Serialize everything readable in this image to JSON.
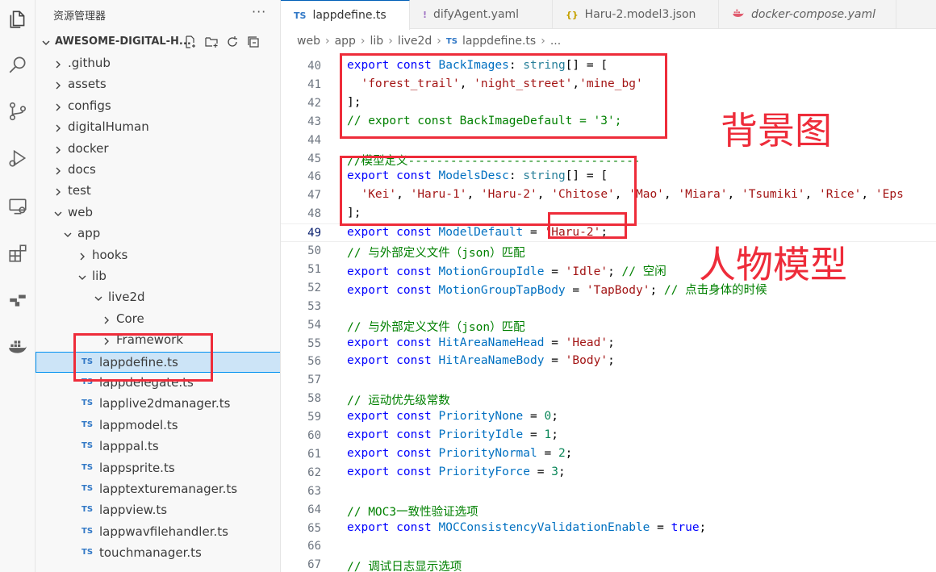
{
  "explorer": {
    "title": "资源管理器",
    "more": "···",
    "project": "AWESOME-DIGITAL-H...",
    "tree": [
      {
        "label": ".github",
        "depth": 0,
        "type": "folder",
        "open": false
      },
      {
        "label": "assets",
        "depth": 0,
        "type": "folder",
        "open": false
      },
      {
        "label": "configs",
        "depth": 0,
        "type": "folder",
        "open": false
      },
      {
        "label": "digitalHuman",
        "depth": 0,
        "type": "folder",
        "open": false
      },
      {
        "label": "docker",
        "depth": 0,
        "type": "folder",
        "open": false
      },
      {
        "label": "docs",
        "depth": 0,
        "type": "folder",
        "open": false
      },
      {
        "label": "test",
        "depth": 0,
        "type": "folder",
        "open": false
      },
      {
        "label": "web",
        "depth": 0,
        "type": "folder",
        "open": true
      },
      {
        "label": "app",
        "depth": 1,
        "type": "folder",
        "open": true
      },
      {
        "label": "hooks",
        "depth": 2,
        "type": "folder",
        "open": false
      },
      {
        "label": "lib",
        "depth": 2,
        "type": "folder",
        "open": true
      },
      {
        "label": "live2d",
        "depth": 3,
        "type": "folder",
        "open": true
      },
      {
        "label": "Core",
        "depth": 4,
        "type": "folder",
        "open": false
      },
      {
        "label": "Framework",
        "depth": 4,
        "type": "folder",
        "open": false
      },
      {
        "label": "lappdefine.ts",
        "depth": 4,
        "type": "ts",
        "selected": true
      },
      {
        "label": "lappdelegate.ts",
        "depth": 4,
        "type": "ts"
      },
      {
        "label": "lapplive2dmanager.ts",
        "depth": 4,
        "type": "ts"
      },
      {
        "label": "lappmodel.ts",
        "depth": 4,
        "type": "ts"
      },
      {
        "label": "lapppal.ts",
        "depth": 4,
        "type": "ts"
      },
      {
        "label": "lappsprite.ts",
        "depth": 4,
        "type": "ts"
      },
      {
        "label": "lapptexturemanager.ts",
        "depth": 4,
        "type": "ts"
      },
      {
        "label": "lappview.ts",
        "depth": 4,
        "type": "ts"
      },
      {
        "label": "lappwavfilehandler.ts",
        "depth": 4,
        "type": "ts"
      },
      {
        "label": "touchmanager.ts",
        "depth": 4,
        "type": "ts"
      }
    ],
    "ts_badge": "TS"
  },
  "tabs": [
    {
      "label": "lappdefine.ts",
      "icon": "TS",
      "icon_color": "#3178c6",
      "active": true
    },
    {
      "label": "difyAgent.yaml",
      "icon": "!",
      "icon_color": "#a074c4",
      "active": false
    },
    {
      "label": "Haru-2.model3.json",
      "icon": "{}",
      "icon_color": "#c5a100",
      "active": false
    },
    {
      "label": "docker-compose.yaml",
      "icon": "docker-icon",
      "icon_color": "#e05a6d",
      "active": false
    }
  ],
  "breadcrumb": [
    "web",
    "app",
    "lib",
    "live2d",
    "lappdefine.ts",
    "..."
  ],
  "code": [
    {
      "n": "40",
      "tokens": [
        [
          "k",
          "export"
        ],
        [
          "p",
          " "
        ],
        [
          "k",
          "const"
        ],
        [
          "p",
          " "
        ],
        [
          "v",
          "BackImages"
        ],
        [
          "p",
          ": "
        ],
        [
          "t",
          "string"
        ],
        [
          "p",
          "[] = ["
        ]
      ]
    },
    {
      "n": "41",
      "tokens": [
        [
          "p",
          "  "
        ],
        [
          "s",
          "'forest_trail'"
        ],
        [
          "p",
          ", "
        ],
        [
          "s",
          "'night_street'"
        ],
        [
          "p",
          ","
        ],
        [
          "s",
          "'mine_bg'"
        ]
      ]
    },
    {
      "n": "42",
      "tokens": [
        [
          "p",
          "];"
        ]
      ]
    },
    {
      "n": "43",
      "tokens": [
        [
          "c",
          "// export const BackImageDefault = '3';"
        ]
      ]
    },
    {
      "n": "44",
      "tokens": []
    },
    {
      "n": "45",
      "tokens": [
        [
          "c",
          "//模型定义---------------------------------"
        ]
      ]
    },
    {
      "n": "46",
      "tokens": [
        [
          "k",
          "export"
        ],
        [
          "p",
          " "
        ],
        [
          "k",
          "const"
        ],
        [
          "p",
          " "
        ],
        [
          "v",
          "ModelsDesc"
        ],
        [
          "p",
          ": "
        ],
        [
          "t",
          "string"
        ],
        [
          "p",
          "[] = ["
        ]
      ]
    },
    {
      "n": "47",
      "tokens": [
        [
          "p",
          "  "
        ],
        [
          "s",
          "'Kei'"
        ],
        [
          "p",
          ", "
        ],
        [
          "s",
          "'Haru-1'"
        ],
        [
          "p",
          ", "
        ],
        [
          "s",
          "'Haru-2'"
        ],
        [
          "p",
          ", "
        ],
        [
          "s",
          "'Chitose'"
        ],
        [
          "p",
          ", "
        ],
        [
          "s",
          "'Mao'"
        ],
        [
          "p",
          ", "
        ],
        [
          "s",
          "'Miara'"
        ],
        [
          "p",
          ", "
        ],
        [
          "s",
          "'Tsumiki'"
        ],
        [
          "p",
          ", "
        ],
        [
          "s",
          "'Rice'"
        ],
        [
          "p",
          ", "
        ],
        [
          "s",
          "'Eps"
        ]
      ]
    },
    {
      "n": "48",
      "tokens": [
        [
          "p",
          "];"
        ]
      ]
    },
    {
      "n": "49",
      "tokens": [
        [
          "k",
          "export"
        ],
        [
          "p",
          " "
        ],
        [
          "k",
          "const"
        ],
        [
          "p",
          " "
        ],
        [
          "v",
          "ModelDefault"
        ],
        [
          "p",
          " = "
        ],
        [
          "s",
          "'Haru-2'"
        ],
        [
          "p",
          ";"
        ]
      ],
      "current": true
    },
    {
      "n": "50",
      "tokens": [
        [
          "c",
          "// 与外部定义文件（json）匹配"
        ]
      ]
    },
    {
      "n": "51",
      "tokens": [
        [
          "k",
          "export"
        ],
        [
          "p",
          " "
        ],
        [
          "k",
          "const"
        ],
        [
          "p",
          " "
        ],
        [
          "v",
          "MotionGroupIdle"
        ],
        [
          "p",
          " = "
        ],
        [
          "s",
          "'Idle'"
        ],
        [
          "p",
          "; "
        ],
        [
          "c",
          "// 空闲"
        ]
      ]
    },
    {
      "n": "52",
      "tokens": [
        [
          "k",
          "export"
        ],
        [
          "p",
          " "
        ],
        [
          "k",
          "const"
        ],
        [
          "p",
          " "
        ],
        [
          "v",
          "MotionGroupTapBody"
        ],
        [
          "p",
          " = "
        ],
        [
          "s",
          "'TapBody'"
        ],
        [
          "p",
          "; "
        ],
        [
          "c",
          "// 点击身体的时候"
        ]
      ]
    },
    {
      "n": "53",
      "tokens": []
    },
    {
      "n": "54",
      "tokens": [
        [
          "c",
          "// 与外部定义文件（json）匹配"
        ]
      ]
    },
    {
      "n": "55",
      "tokens": [
        [
          "k",
          "export"
        ],
        [
          "p",
          " "
        ],
        [
          "k",
          "const"
        ],
        [
          "p",
          " "
        ],
        [
          "v",
          "HitAreaNameHead"
        ],
        [
          "p",
          " = "
        ],
        [
          "s",
          "'Head'"
        ],
        [
          "p",
          ";"
        ]
      ]
    },
    {
      "n": "56",
      "tokens": [
        [
          "k",
          "export"
        ],
        [
          "p",
          " "
        ],
        [
          "k",
          "const"
        ],
        [
          "p",
          " "
        ],
        [
          "v",
          "HitAreaNameBody"
        ],
        [
          "p",
          " = "
        ],
        [
          "s",
          "'Body'"
        ],
        [
          "p",
          ";"
        ]
      ]
    },
    {
      "n": "57",
      "tokens": []
    },
    {
      "n": "58",
      "tokens": [
        [
          "c",
          "// 运动优先级常数"
        ]
      ]
    },
    {
      "n": "59",
      "tokens": [
        [
          "k",
          "export"
        ],
        [
          "p",
          " "
        ],
        [
          "k",
          "const"
        ],
        [
          "p",
          " "
        ],
        [
          "v",
          "PriorityNone"
        ],
        [
          "p",
          " = "
        ],
        [
          "n",
          "0"
        ],
        [
          "p",
          ";"
        ]
      ]
    },
    {
      "n": "60",
      "tokens": [
        [
          "k",
          "export"
        ],
        [
          "p",
          " "
        ],
        [
          "k",
          "const"
        ],
        [
          "p",
          " "
        ],
        [
          "v",
          "PriorityIdle"
        ],
        [
          "p",
          " = "
        ],
        [
          "n",
          "1"
        ],
        [
          "p",
          ";"
        ]
      ]
    },
    {
      "n": "61",
      "tokens": [
        [
          "k",
          "export"
        ],
        [
          "p",
          " "
        ],
        [
          "k",
          "const"
        ],
        [
          "p",
          " "
        ],
        [
          "v",
          "PriorityNormal"
        ],
        [
          "p",
          " = "
        ],
        [
          "n",
          "2"
        ],
        [
          "p",
          ";"
        ]
      ]
    },
    {
      "n": "62",
      "tokens": [
        [
          "k",
          "export"
        ],
        [
          "p",
          " "
        ],
        [
          "k",
          "const"
        ],
        [
          "p",
          " "
        ],
        [
          "v",
          "PriorityForce"
        ],
        [
          "p",
          " = "
        ],
        [
          "n",
          "3"
        ],
        [
          "p",
          ";"
        ]
      ]
    },
    {
      "n": "63",
      "tokens": []
    },
    {
      "n": "64",
      "tokens": [
        [
          "c",
          "// MOC3一致性验证选项"
        ]
      ]
    },
    {
      "n": "65",
      "tokens": [
        [
          "k",
          "export"
        ],
        [
          "p",
          " "
        ],
        [
          "k",
          "const"
        ],
        [
          "p",
          " "
        ],
        [
          "v",
          "MOCConsistencyValidationEnable"
        ],
        [
          "p",
          " = "
        ],
        [
          "k",
          "true"
        ],
        [
          "p",
          ";"
        ]
      ]
    },
    {
      "n": "66",
      "tokens": []
    },
    {
      "n": "67",
      "tokens": [
        [
          "c",
          "// 调试日志显示选项"
        ]
      ]
    }
  ],
  "annotations": {
    "background_label": "背景图",
    "model_label": "人物模型",
    "color": "#ee2c3a"
  },
  "colors": {
    "accent": "#005fb8",
    "selection": "#cce4f7",
    "ts_badge": "#3178c6"
  }
}
